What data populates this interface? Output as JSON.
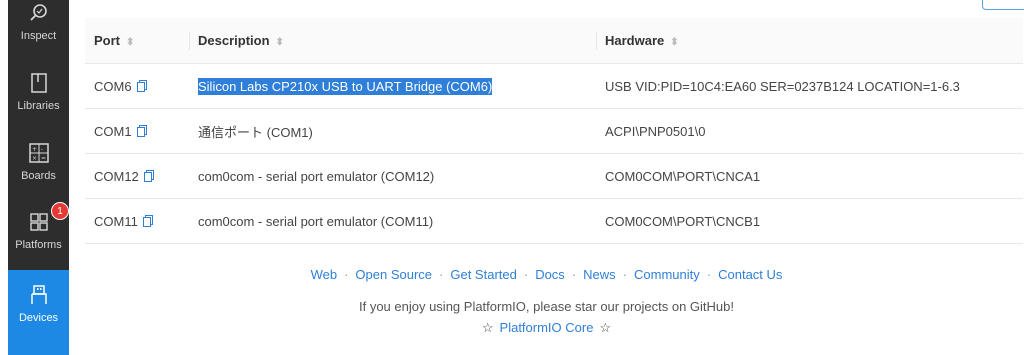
{
  "sidebar": {
    "items": [
      {
        "label": "Inspect",
        "icon": "search-icon"
      },
      {
        "label": "Libraries",
        "icon": "book-icon"
      },
      {
        "label": "Boards",
        "icon": "calculator-icon"
      },
      {
        "label": "Platforms",
        "icon": "grid-icon",
        "badge": "1"
      },
      {
        "label": "Devices",
        "icon": "usb-icon",
        "active": true
      }
    ]
  },
  "table": {
    "headers": {
      "port": "Port",
      "description": "Description",
      "hardware": "Hardware"
    },
    "rows": [
      {
        "port": "COM6",
        "description": "Silicon Labs CP210x USB to UART Bridge (COM6)",
        "hardware": "USB VID:PID=10C4:EA60 SER=0237B124 LOCATION=1-6.3"
      },
      {
        "port": "COM1",
        "description": "通信ポート (COM1)",
        "hardware": "ACPI\\PNP0501\\0"
      },
      {
        "port": "COM12",
        "description": "com0com - serial port emulator (COM12)",
        "hardware": "COM0COM\\PORT\\CNCA1"
      },
      {
        "port": "COM11",
        "description": "com0com - serial port emulator (COM11)",
        "hardware": "COM0COM\\PORT\\CNCB1"
      }
    ]
  },
  "footer": {
    "links": [
      "Web",
      "Open Source",
      "Get Started",
      "Docs",
      "News",
      "Community",
      "Contact Us"
    ],
    "message": "If you enjoy using PlatformIO, please star our projects on GitHub!",
    "core_link": "PlatformIO Core"
  },
  "colors": {
    "accent": "#1e88e5",
    "link": "#2f7fd8",
    "sidebar_bg": "#2d2d2d",
    "badge": "#e53935",
    "selection": "#2f7fd8"
  }
}
